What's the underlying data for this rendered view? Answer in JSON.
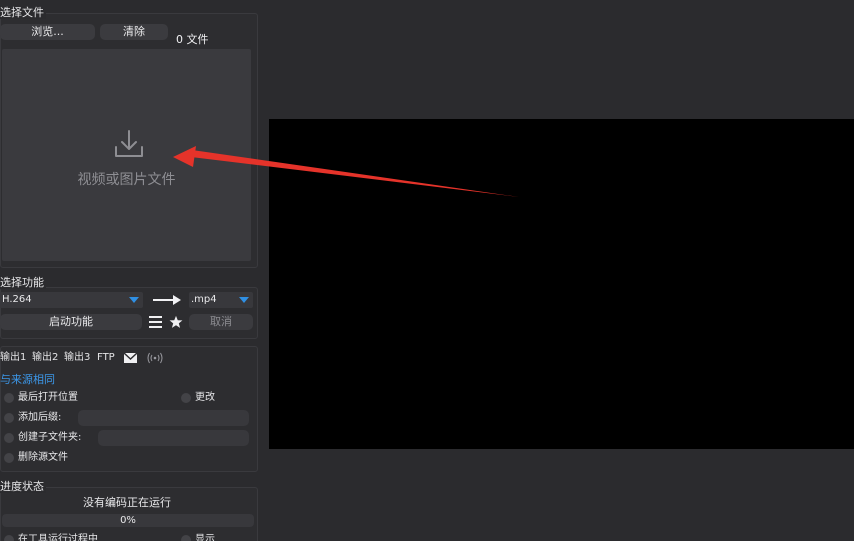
{
  "file_section": {
    "title": "选择文件",
    "browse_label": "浏览...",
    "clear_label": "清除",
    "file_count": "0 文件",
    "drop_hint": "视频或图片文件"
  },
  "function_section": {
    "title": "选择功能",
    "codec_value": "H.264",
    "format_value": ".mp4",
    "start_label": "启动功能",
    "cancel_label": "取消"
  },
  "output_section": {
    "tabs": [
      "输出1",
      "输出2",
      "输出3",
      "FTP"
    ],
    "same_as_source": "与来源相同",
    "last_open_label": "最后打开位置",
    "change_label": "更改",
    "add_suffix_label": "添加后缀:",
    "add_suffix_value": "",
    "create_subfolder_label": "创建子文件夹:",
    "create_subfolder_value": "",
    "delete_source_label": "删除源文件"
  },
  "progress_section": {
    "title": "进度状态",
    "status_text": "没有编码正在运行",
    "progress_text": "0%",
    "progress_value": 0,
    "bottom_left_partial": "在工具运行过程中",
    "bottom_right_partial": "显示"
  },
  "colors": {
    "background": "#2b2b2e",
    "accent": "#2f8fe3",
    "annotation_arrow": "#e5332a",
    "preview": "#000000"
  },
  "icons": {
    "download": "download-icon",
    "arrow": "right-arrow-icon",
    "menu": "hamburger-menu-icon",
    "star": "star-icon",
    "mail": "mail-icon",
    "broadcast": "broadcast-icon"
  }
}
